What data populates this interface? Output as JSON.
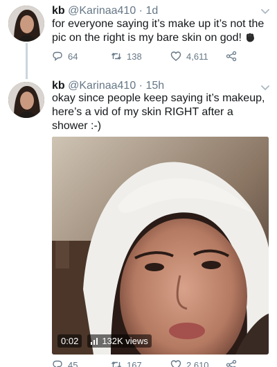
{
  "tweets": [
    {
      "name": "kb",
      "handle": "@Karinaa410",
      "time": "1d",
      "text": "for everyone saying it’s make up it’s not the pic on the right is my bare skin on god!",
      "emoji": "raised-fist",
      "actions": {
        "replies": "64",
        "retweets": "138",
        "likes": "4,611"
      }
    },
    {
      "name": "kb",
      "handle": "@Karinaa410",
      "time": "15h",
      "text": "okay since people keep saying it’s makeup, here’s a vid of my skin RIGHT after a shower :-)",
      "video": {
        "elapsed": "0:02",
        "views": "132K views"
      },
      "actions": {
        "replies": "45",
        "retweets": "167",
        "likes": "2,610"
      }
    }
  ],
  "separator": "·",
  "icons": [
    "chevron-down-icon",
    "reply-icon",
    "retweet-icon",
    "like-icon",
    "share-icon",
    "volume-bars-icon"
  ],
  "colors": {
    "text": "#14171a",
    "secondary": "#657786",
    "thread_line": "#ccd6dd"
  }
}
